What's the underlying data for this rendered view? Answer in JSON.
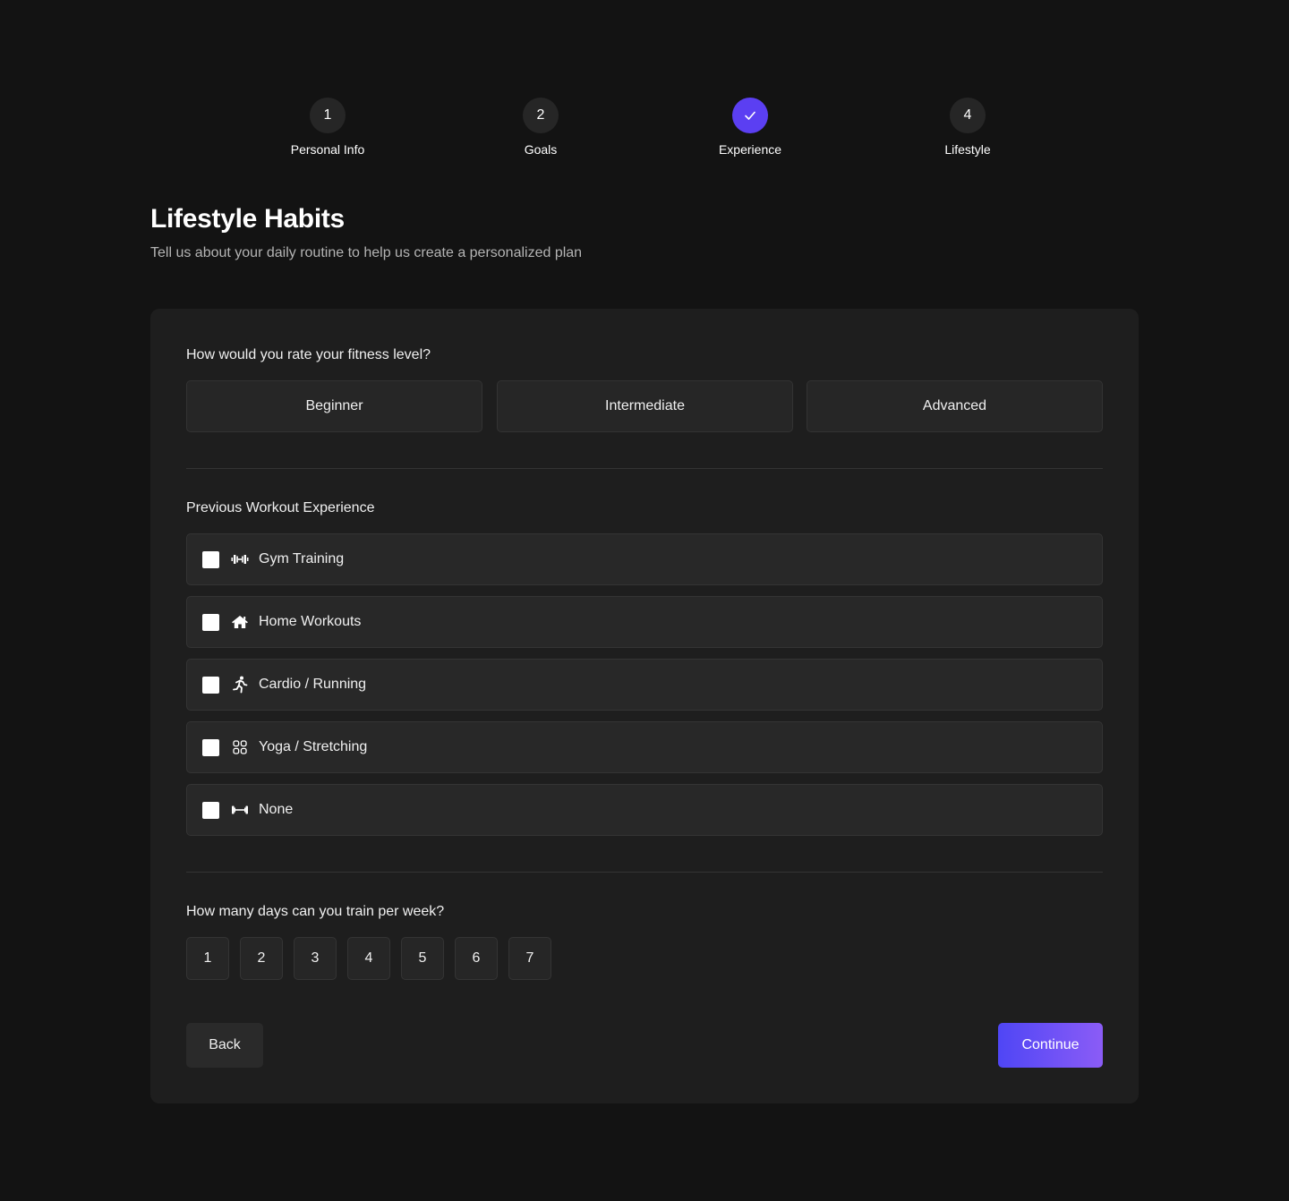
{
  "stepper": {
    "steps": [
      {
        "number": "1",
        "label": "Personal Info",
        "status": "upcoming"
      },
      {
        "number": "2",
        "label": "Goals",
        "status": "upcoming"
      },
      {
        "number": "",
        "label": "Experience",
        "status": "completed",
        "icon": "check-icon"
      },
      {
        "number": "4",
        "label": "Lifestyle",
        "status": "upcoming"
      }
    ]
  },
  "header": {
    "title": "Lifestyle Habits",
    "subtitle": "Tell us about your daily routine to help us create a personalized plan"
  },
  "fitness_level": {
    "question": "How would you rate your fitness level?",
    "options": [
      "Beginner",
      "Intermediate",
      "Advanced"
    ]
  },
  "experience": {
    "question": "Previous Workout Experience",
    "options": [
      {
        "label": "Gym Training",
        "icon": "dumbbell-icon",
        "checked": false
      },
      {
        "label": "Home Workouts",
        "icon": "home-icon",
        "checked": false
      },
      {
        "label": "Cardio / Running",
        "icon": "running-icon",
        "checked": false
      },
      {
        "label": "Yoga / Stretching",
        "icon": "grid-icon",
        "checked": false
      },
      {
        "label": "None",
        "icon": "barbell-icon",
        "checked": false
      }
    ]
  },
  "training_days": {
    "question": "How many days can you train per week?",
    "options": [
      "1",
      "2",
      "3",
      "4",
      "5",
      "6",
      "7"
    ]
  },
  "actions": {
    "back_label": "Back",
    "continue_label": "Continue"
  },
  "colors": {
    "accent": "#5b3ff2",
    "continue_gradient_start": "#4f46f5",
    "continue_gradient_end": "#8b5cf6",
    "background": "#131313",
    "card": "#1e1e1e"
  }
}
